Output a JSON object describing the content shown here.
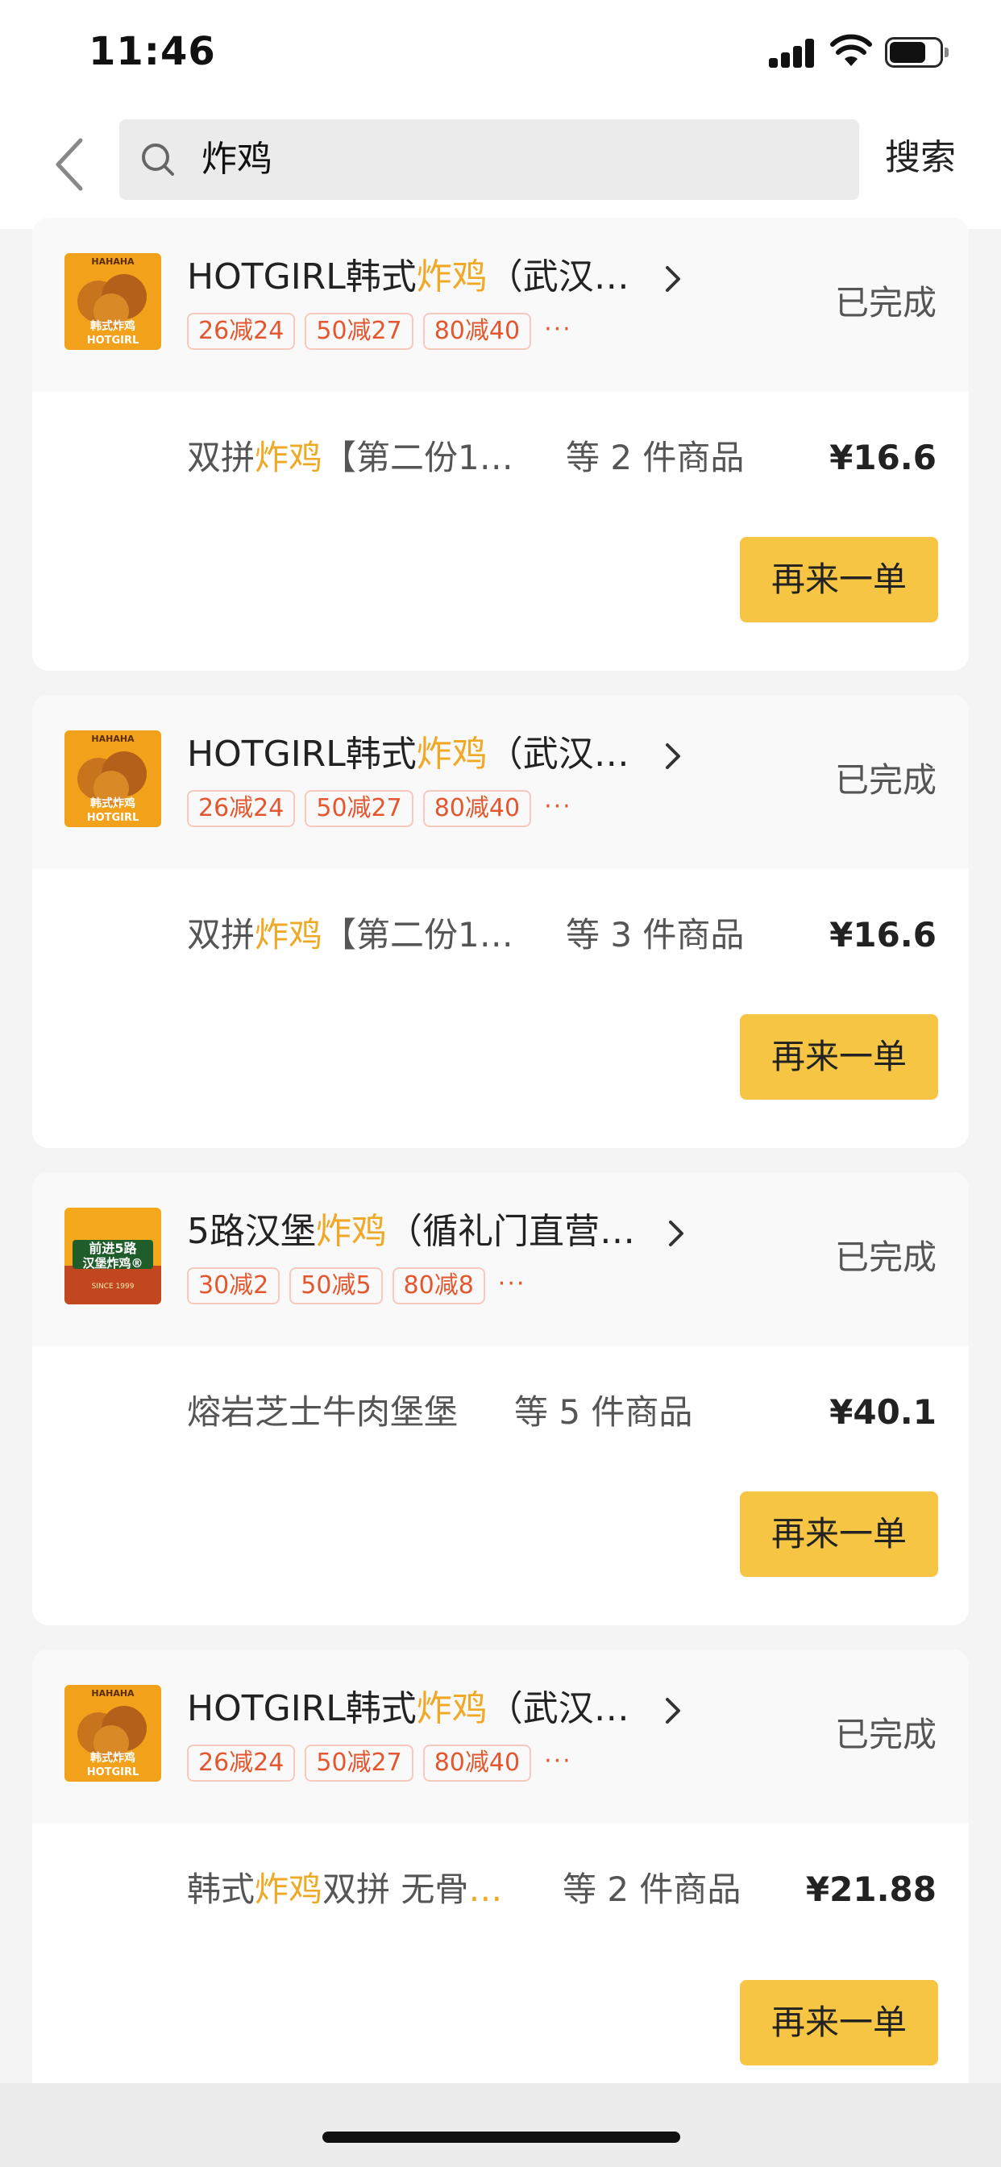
{
  "status_bar": {
    "time": "11:46"
  },
  "search": {
    "value": "炸鸡",
    "button_label": "搜索"
  },
  "orders": [
    {
      "shop_name_prefix": "HOTGIRL韩式",
      "shop_name_highlight": "炸鸡",
      "shop_name_suffix": "（武汉…",
      "tags": [
        "26减24",
        "50减27",
        "80减40"
      ],
      "tags_more": "···",
      "status": "已完成",
      "items_prefix": "双拼",
      "items_highlight": "炸鸡",
      "items_suffix": "【第二份1…",
      "items_count_text": "等 2 件商品",
      "price": "¥16.6",
      "reorder_label": "再来一单"
    },
    {
      "shop_name_prefix": "HOTGIRL韩式",
      "shop_name_highlight": "炸鸡",
      "shop_name_suffix": "（武汉…",
      "tags": [
        "26减24",
        "50减27",
        "80减40"
      ],
      "tags_more": "···",
      "status": "已完成",
      "items_prefix": "双拼",
      "items_highlight": "炸鸡",
      "items_suffix": "【第二份1…",
      "items_count_text": "等 3 件商品",
      "price": "¥16.6",
      "reorder_label": "再来一单"
    },
    {
      "shop_name_prefix": "5路汉堡",
      "shop_name_highlight": "炸鸡",
      "shop_name_suffix": "（循礼门直营…",
      "tags": [
        "30减2",
        "50减5",
        "80减8"
      ],
      "tags_more": "···",
      "status": "已完成",
      "items_prefix": "熔岩芝士牛肉堡堡",
      "items_highlight": "",
      "items_suffix": "",
      "items_count_text": "等 5 件商品",
      "price": "¥40.1",
      "reorder_label": "再来一单"
    },
    {
      "shop_name_prefix": "HOTGIRL韩式",
      "shop_name_highlight": "炸鸡",
      "shop_name_suffix": "（武汉…",
      "tags": [
        "26减24",
        "50减27",
        "80减40"
      ],
      "tags_more": "···",
      "status": "已完成",
      "items_prefix": "韩式",
      "items_highlight": "炸鸡",
      "items_suffix": "双拼 无骨…",
      "items_count_text": "等 2 件商品",
      "price": "¥21.88",
      "reorder_label": "再来一单"
    }
  ],
  "logos": {
    "hotgirl": {
      "top": "HAHAHA",
      "mid": "韩式炸鸡",
      "bottom": "HOTGIRL"
    },
    "burger": {
      "line1": "前进5路",
      "line2": "汉堡炸鸡®",
      "line3": "SINCE 1999"
    }
  },
  "colors": {
    "highlight": "#f0a927",
    "reorder_button": "#f7c544",
    "tag_text": "#e4572e"
  }
}
